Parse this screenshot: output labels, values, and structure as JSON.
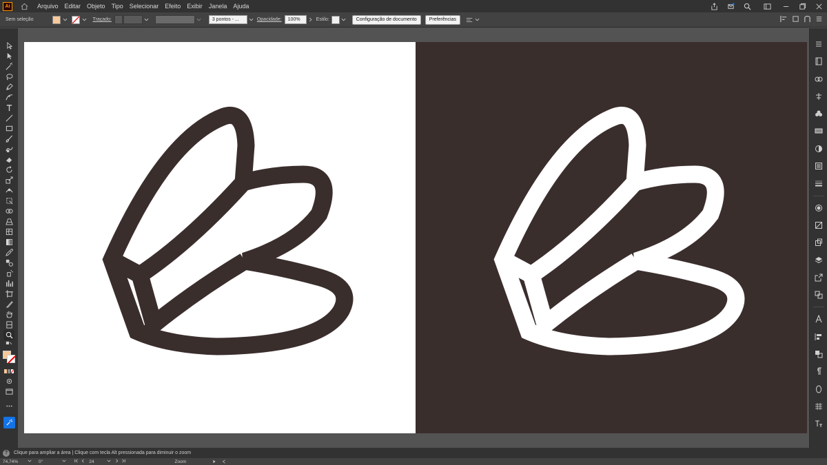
{
  "app": {
    "logo_text": "Ai"
  },
  "menu": [
    "Arquivo",
    "Editar",
    "Objeto",
    "Tipo",
    "Selecionar",
    "Efeito",
    "Exibir",
    "Janela",
    "Ajuda"
  ],
  "control_bar": {
    "selection_label": "Sem seleção",
    "fill_color": "#f8c99a",
    "stroke_label": "Traçado:",
    "brush_label": "3 pontos - ...",
    "opacity_label": "Opacidade:",
    "opacity_value": "100%",
    "style_label": "Estilo:",
    "doc_setup_label": "Configuração de documento",
    "preferences_label": "Preferências"
  },
  "artboards": {
    "left_background": "#ffffff",
    "left_mark_color": "#3a2e2d",
    "right_background": "#3a2e2d",
    "right_mark_color": "#ffffff"
  },
  "hint": {
    "help_glyph": "?",
    "text": "Clique para ampliar a área | Clique com tecla Alt pressionada para diminuir o zoom"
  },
  "status_bar": {
    "zoom": "74,74%",
    "rotation": "0°",
    "artboard_number": "24",
    "tool_name": "Zoom"
  },
  "icons": {
    "left_tools": [
      "selection-icon",
      "direct-selection-icon",
      "magic-wand-icon",
      "lasso-icon",
      "pen-icon",
      "curvature-icon",
      "type-icon",
      "line-icon",
      "rectangle-icon",
      "paintbrush-icon",
      "shaper-icon",
      "eraser-icon",
      "rotate-icon",
      "scale-icon",
      "warp-icon",
      "free-transform-icon",
      "shape-builder-icon",
      "perspective-icon",
      "mesh-icon",
      "gradient-icon",
      "eyedropper-icon",
      "blend-icon",
      "symbol-sprayer-icon",
      "column-graph-icon",
      "artboard-icon",
      "slice-icon",
      "hand-icon",
      "print-tiling-icon",
      "zoom-icon"
    ],
    "right_panels": [
      "properties-icon",
      "libraries-icon",
      "cc-icon",
      "appearance-icon",
      "symbols-icon",
      "gradient-panel-icon",
      "color-guide-icon",
      "brushes-icon",
      "stroke-icon",
      "transparency-icon",
      "graphic-styles-icon",
      "asset-export-icon",
      "layers-icon",
      "export-icon",
      "artboards-panel-icon",
      "character-icon",
      "align-icon",
      "pathfinder-icon",
      "paragraph-icon",
      "opentype-icon",
      "glyphs-icon",
      "text-style-icon"
    ]
  }
}
